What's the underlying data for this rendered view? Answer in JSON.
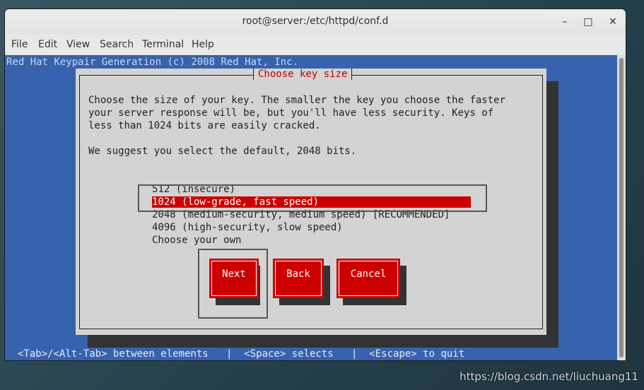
{
  "window": {
    "title": "root@server:/etc/httpd/conf.d",
    "controls": {
      "minimize": "–",
      "maximize": "□",
      "close": "✕"
    }
  },
  "menubar": {
    "items": [
      "File",
      "Edit",
      "View",
      "Search",
      "Terminal",
      "Help"
    ]
  },
  "terminal": {
    "header": "Red Hat Keypair Generation (c) 2008 Red Hat, Inc.",
    "dialog": {
      "title": "Choose key size",
      "description": [
        "Choose the size of your key. The smaller the key you choose the faster",
        "your server response will be, but you'll have less security. Keys of",
        "less than 1024 bits are easily cracked."
      ],
      "suggestion": "We suggest you select the default, 2048 bits.",
      "options": [
        "512 (insecure)",
        "1024 (low-grade, fast speed)",
        "2048 (medium-security, medium speed) [RECOMMENDED]",
        "4096 (high-security, slow speed)",
        "Choose your own"
      ],
      "selected_option": "1024 (low-grade, fast speed)",
      "buttons": {
        "next": "Next",
        "back": "Back",
        "cancel": "Cancel"
      }
    },
    "status": "<Tab>/<Alt-Tab> between elements   |  <Space> selects   |  <Escape> to quit"
  },
  "watermark": "https://blog.csdn.net/liuchuang11",
  "colors": {
    "terminal_bg": "#3762ad",
    "dialog_bg": "#d3d3d3",
    "accent_red": "#cc0000"
  }
}
